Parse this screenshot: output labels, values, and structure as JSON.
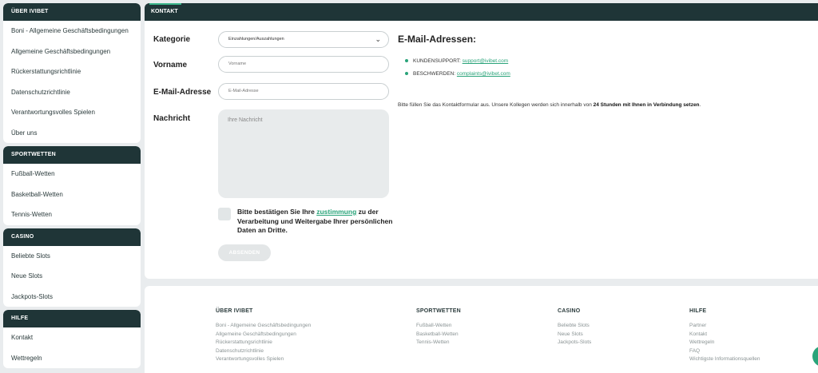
{
  "sidebar": {
    "sections": [
      {
        "title": "ÜBER IVIBET",
        "items": [
          "Boni - Allgemeine Geschäftsbedingungen",
          "Allgemeine Geschäftsbedingungen",
          "Rückerstattungsrichtlinie",
          "Datenschutzrichtlinie",
          "Verantwortungsvolles Spielen",
          "Über uns"
        ]
      },
      {
        "title": "SPORTWETTEN",
        "items": [
          "Fußball-Wetten",
          "Basketball-Wetten",
          "Tennis-Wetten"
        ]
      },
      {
        "title": "CASINO",
        "items": [
          "Beliebte Slots",
          "Neue Slots",
          "Jackpots-Slots"
        ]
      },
      {
        "title": "HILFE",
        "items": [
          "Kontakt",
          "Wettregeln"
        ]
      }
    ]
  },
  "tab": {
    "label": "KONTAKT"
  },
  "form": {
    "category_label": "Kategorie",
    "category_value": "Einzahlungen/Auszahlungen",
    "firstname_label": "Vorname",
    "firstname_placeholder": "Vorname",
    "email_label": "E-Mail-Adresse",
    "email_placeholder": "E-Mail-Adresse",
    "message_label": "Nachricht",
    "message_placeholder": "Ihre Nachricht",
    "consent_prefix": "Bitte bestätigen Sie Ihre ",
    "consent_link": "zustimmung",
    "consent_suffix": " zu der Verarbeitung und Weitergabe Ihrer persönlichen Daten an Dritte.",
    "submit_label": "ABSENDEN"
  },
  "emails": {
    "title": "E-Mail-Adressen:",
    "support_label": "KUNDENSUPPORT: ",
    "support_email": "support@ivibet.com",
    "complaints_label": "BESCHWERDEN: ",
    "complaints_email": "complaints@ivibet.com",
    "info_prefix": "Bitte füllen Sie das Kontaktformular aus. Unsere Kollegen werden sich innerhalb von ",
    "info_bold": "24 Stunden mit Ihnen in Verbindung setzen",
    "info_suffix": "."
  },
  "footer": {
    "columns": [
      {
        "title": "ÜBER IVIBET",
        "items": [
          "Boni - Allgemeine Geschäftsbedingungen",
          "Allgemeine Geschäftsbedingungen",
          "Rückerstattungsrichtlinie",
          "Datenschutzrichtlinie",
          "Verantwortungsvolles Spielen"
        ]
      },
      {
        "title": "SPORTWETTEN",
        "items": [
          "Fußball-Wetten",
          "Basketball-Wetten",
          "Tennis-Wetten"
        ]
      },
      {
        "title": "CASINO",
        "items": [
          "Beliebte Slots",
          "Neue Slots",
          "Jackpots-Slots"
        ]
      },
      {
        "title": "HILFE",
        "items": [
          "Partner",
          "Kontakt",
          "Wettregeln",
          "FAQ",
          "Wichtigste Informationsquellen"
        ]
      }
    ]
  },
  "colors": {
    "dark": "#1f3537",
    "accent": "#2aa47a",
    "background": "#e9ecee"
  },
  "icons": {
    "select": "chevron-down-icon",
    "chat": "chat-icon"
  }
}
